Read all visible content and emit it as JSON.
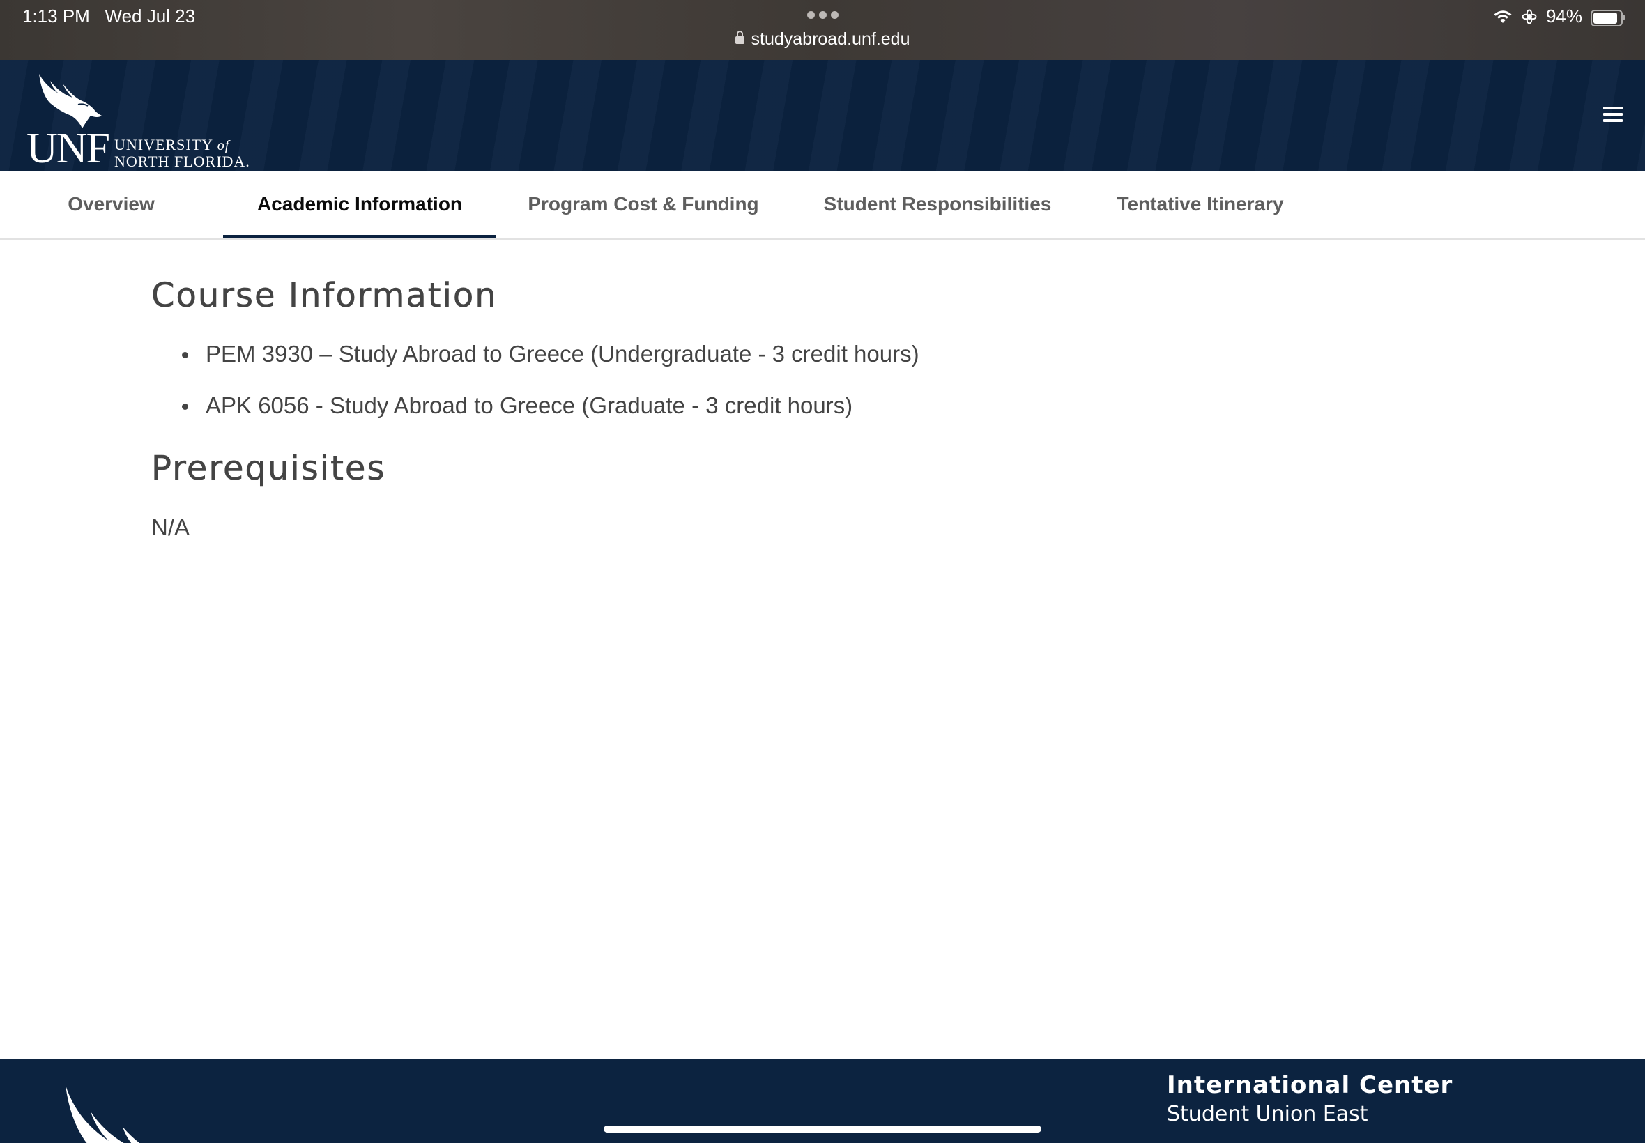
{
  "status_bar": {
    "time": "1:13 PM",
    "date": "Wed Jul 23",
    "url": "studyabroad.unf.edu",
    "battery": "94%",
    "battery_level": 0.94
  },
  "header": {
    "logo_text": "UNF",
    "logo_univ_line1": "UNIVERSITY",
    "logo_univ_of": "of",
    "logo_univ_line2": "NORTH FLORIDA."
  },
  "tabs": [
    {
      "label": "Overview"
    },
    {
      "label": "Academic Information"
    },
    {
      "label": "Program Cost & Funding"
    },
    {
      "label": "Student Responsibilities"
    },
    {
      "label": "Tentative Itinerary"
    }
  ],
  "active_tab": "Academic Information",
  "main": {
    "course_heading": "Course Information",
    "courses": [
      "PEM 3930 – Study Abroad to Greece (Undergraduate - 3 credit hours)",
      "APK 6056 - Study Abroad to Greece (Graduate - 3 credit hours)"
    ],
    "prereq_heading": "Prerequisites",
    "prereq_text": "N/A"
  },
  "footer": {
    "title": "International Center",
    "subtitle": "Student Union East"
  },
  "colors": {
    "brand_navy": "#0b223f",
    "text_gray": "#444444"
  }
}
